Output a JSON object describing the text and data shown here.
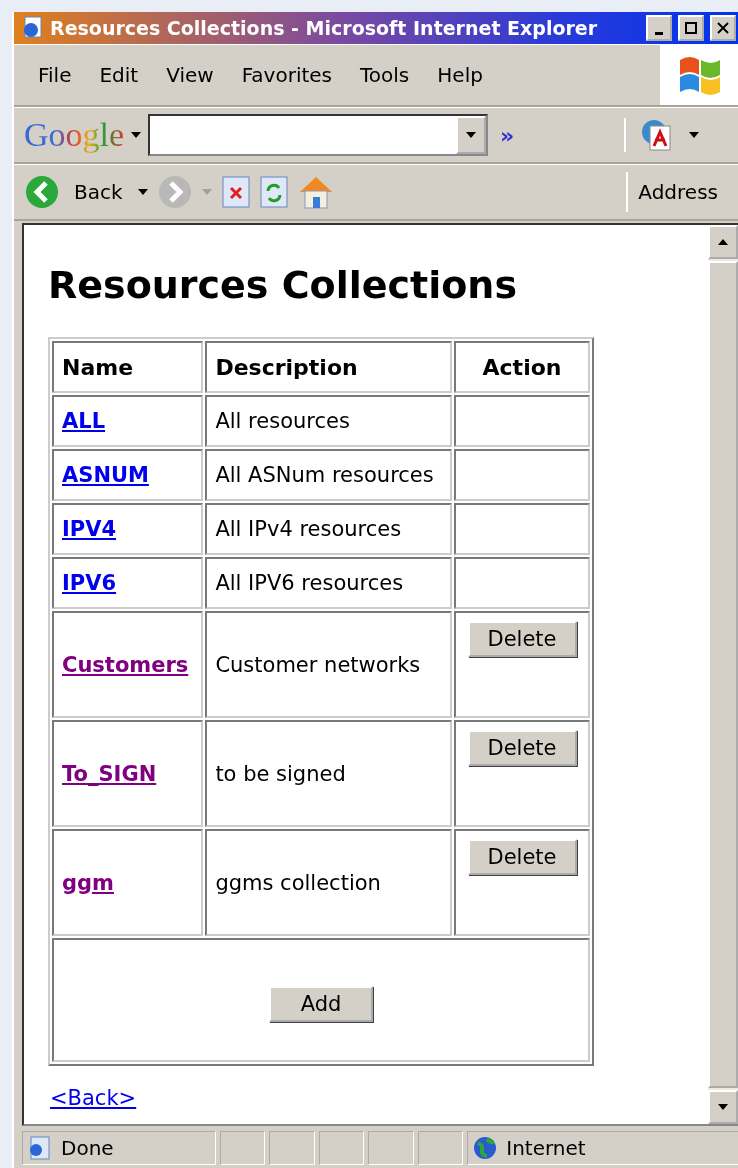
{
  "window": {
    "title": "Resources Collections - Microsoft Internet Explorer"
  },
  "menu": [
    "File",
    "Edit",
    "View",
    "Favorites",
    "Tools",
    "Help"
  ],
  "google_bar": {
    "logo": "Google",
    "more": "»"
  },
  "toolbar": {
    "back": "Back",
    "address": "Address"
  },
  "page": {
    "heading": "Resources Collections",
    "columns": [
      "Name",
      "Description",
      "Action"
    ],
    "rows": [
      {
        "name": "ALL",
        "visited": false,
        "description": "All resources"
      },
      {
        "name": "ASNUM",
        "visited": false,
        "description": "All ASNum resources"
      },
      {
        "name": "IPV4",
        "visited": false,
        "description": "All IPv4 resources"
      },
      {
        "name": "IPV6",
        "visited": false,
        "description": "All IPV6 resources"
      },
      {
        "name": "Customers",
        "visited": true,
        "description": "Customer networks",
        "action": "Delete"
      },
      {
        "name": "To_SIGN",
        "visited": true,
        "description": "to be signed",
        "action": "Delete"
      },
      {
        "name": "ggm",
        "visited": true,
        "description": "ggms collection",
        "action": "Delete"
      }
    ],
    "add_button": "Add",
    "back_link": "<Back>"
  },
  "status_bar": {
    "status": "Done",
    "zone": "Internet"
  }
}
